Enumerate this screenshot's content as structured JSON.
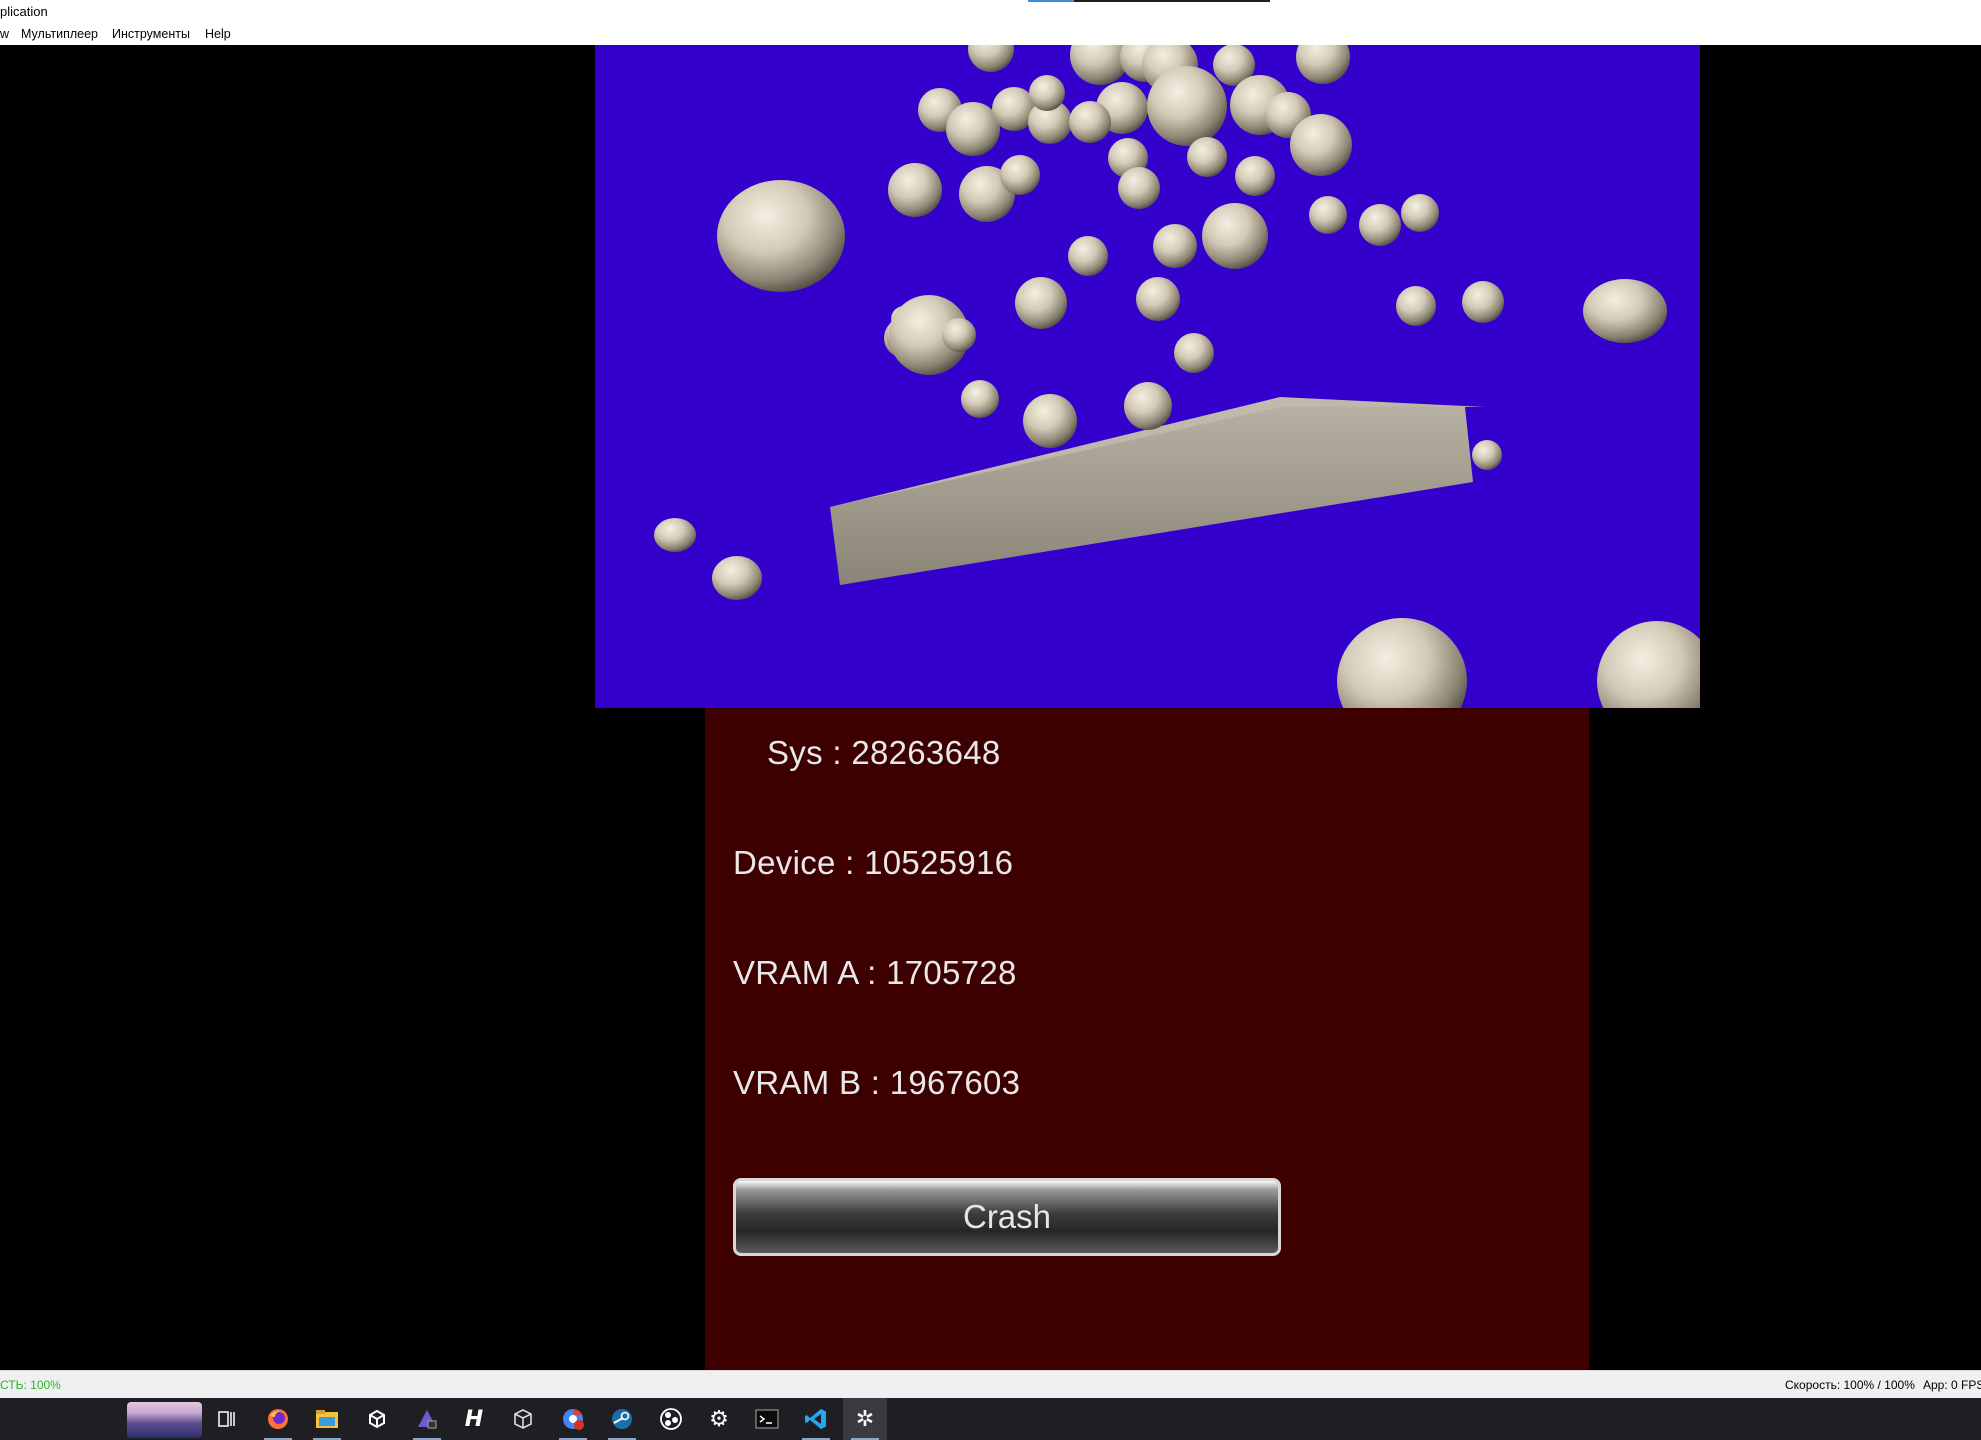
{
  "window": {
    "title": "plication",
    "progress_fraction": 0.19
  },
  "menu": {
    "items": [
      "w",
      "Мультиплеер",
      "Инструменты",
      "Help"
    ]
  },
  "bottom_screen": {
    "stats": {
      "sys": "Sys : 28263648",
      "device": "Device : 10525916",
      "vram_a": "VRAM A : 1705728",
      "vram_b": "VRAM B : 1967603"
    },
    "crash_label": "Crash"
  },
  "statusbar": {
    "left": "СТЬ: 100%",
    "speed": "Скорость: 100% / 100%",
    "fps": "App: 0 FPS"
  },
  "colors": {
    "top_screen_bg": "#3300cc",
    "bottom_screen_bg": "#3d0000",
    "sphere": "#d8d2c2"
  },
  "taskbar": {
    "icons": [
      "task-view-icon",
      "firefox-icon",
      "file-explorer-icon",
      "unity-icon",
      "dev-tool-icon",
      "heroic-icon",
      "box-icon",
      "chrome-icon",
      "steam-icon",
      "obs-icon",
      "settings-icon",
      "terminal-icon",
      "vscode-icon",
      "emulator-icon"
    ]
  }
}
